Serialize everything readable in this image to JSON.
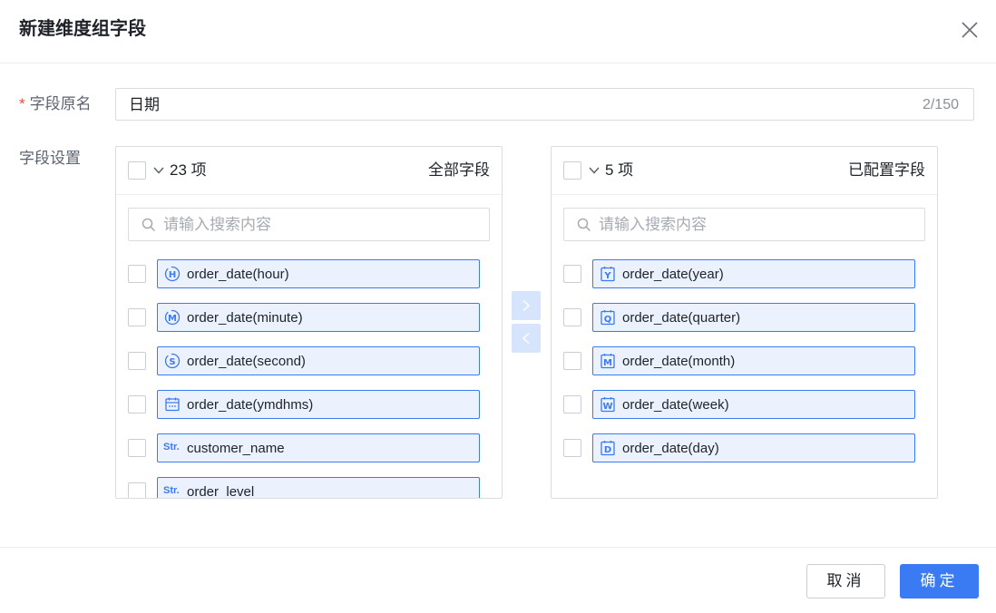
{
  "dialog": {
    "title": "新建维度组字段",
    "close_icon": "close-icon"
  },
  "field_name": {
    "label": "字段原名",
    "required_mark": "*",
    "value": "日期",
    "counter": "2/150"
  },
  "field_settings": {
    "label": "字段设置"
  },
  "left_panel": {
    "count": "23 项",
    "title": "全部字段",
    "search_placeholder": "请输入搜索内容",
    "items": [
      {
        "label": "order_date(hour)",
        "icon": "H"
      },
      {
        "label": "order_date(minute)",
        "icon": "M"
      },
      {
        "label": "order_date(second)",
        "icon": "S"
      },
      {
        "label": "order_date(ymdhms)",
        "icon": "calendar"
      },
      {
        "label": "customer_name",
        "icon": "Str."
      },
      {
        "label": "order_level",
        "icon": "Str."
      }
    ]
  },
  "right_panel": {
    "count": "5 项",
    "title": "已配置字段",
    "search_placeholder": "请输入搜索内容",
    "items": [
      {
        "label": "order_date(year)",
        "icon": "Y"
      },
      {
        "label": "order_date(quarter)",
        "icon": "Q"
      },
      {
        "label": "order_date(month)",
        "icon": "M"
      },
      {
        "label": "order_date(week)",
        "icon": "W"
      },
      {
        "label": "order_date(day)",
        "icon": "D"
      }
    ]
  },
  "footer": {
    "cancel_label": "取消",
    "ok_label": "确定"
  },
  "colors": {
    "accent": "#3a7af2",
    "chip_bg": "#ebf1fd",
    "required": "#f5483b"
  }
}
